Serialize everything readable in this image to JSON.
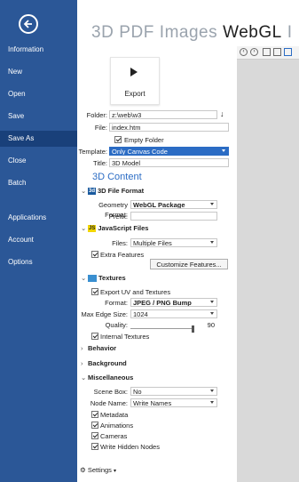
{
  "sidebar": {
    "back_icon": "back-arrow-icon",
    "items": [
      {
        "label": "Information",
        "active": false
      },
      {
        "label": "New",
        "active": false
      },
      {
        "label": "Open",
        "active": false
      },
      {
        "label": "Save",
        "active": false
      },
      {
        "label": "Save As",
        "active": true
      },
      {
        "label": "Close",
        "active": false
      },
      {
        "label": "Batch",
        "active": false
      },
      {
        "label": "Applications",
        "active": false
      },
      {
        "label": "Account",
        "active": false
      },
      {
        "label": "Options",
        "active": false
      }
    ],
    "bg_color": "#2b5797",
    "active_color": "#19407a"
  },
  "tabs": [
    "3D",
    "PDF",
    "Images",
    "WebGL",
    "I"
  ],
  "active_tab": "WebGL",
  "export": {
    "label": "Export",
    "icon": "play-icon"
  },
  "form": {
    "folder_label": "Folder:",
    "folder_value": "z:\\web\\w3",
    "file_label": "File:",
    "file_value": "index.htm",
    "empty_folder_label": "Empty Folder",
    "template_label": "Template:",
    "template_value": "Only Canvas Code",
    "title_label": "Title:",
    "title_value": "3D Model"
  },
  "content_title": "3D Content",
  "file_format": {
    "heading": "3D File Format",
    "badge": "3d",
    "geometry_label": "Geometry Format:",
    "geometry_value": "WebGL Package",
    "prefix_label": "Prefix:",
    "prefix_value": ""
  },
  "js_files": {
    "heading": "JavaScript Files",
    "badge": "JS",
    "files_label": "Files:",
    "files_value": "Multiple Files",
    "extra_label": "Extra Features",
    "customize_label": "Customize Features..."
  },
  "textures": {
    "heading": "Textures",
    "export_uv_label": "Export UV and Textures",
    "format_label": "Format:",
    "format_value": "JPEG / PNG Bump",
    "max_edge_label": "Max Edge Size:",
    "max_edge_value": "1024",
    "quality_label": "Quality:",
    "quality_value": "90",
    "internal_label": "Internal Textures"
  },
  "behavior_heading": "Behavior",
  "background_heading": "Background",
  "misc": {
    "heading": "Miscellaneous",
    "scene_box_label": "Scene Box:",
    "scene_box_value": "No",
    "node_name_label": "Node Name:",
    "node_name_value": "Write Names",
    "metadata_label": "Metadata",
    "animations_label": "Animations",
    "cameras_label": "Cameras",
    "hidden_nodes_label": "Write Hidden Nodes"
  },
  "settings_label": "Settings",
  "accent_color": "#2b6cc4"
}
